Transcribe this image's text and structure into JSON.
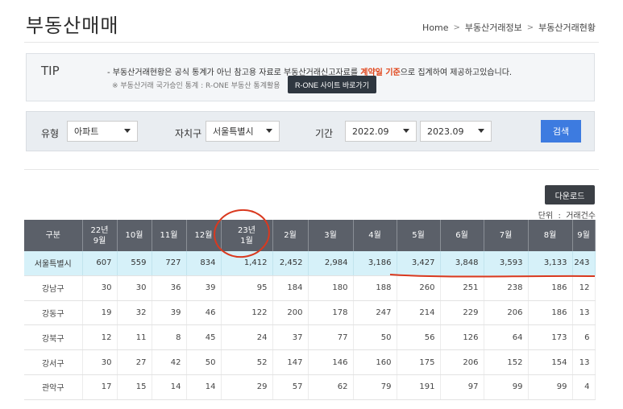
{
  "page": {
    "title": "부동산매매",
    "breadcrumb": [
      "Home",
      "부동산거래정보",
      "부동산거래현황"
    ],
    "breadcrumb_sep": ">"
  },
  "tip": {
    "label": "TIP",
    "line1_pre": "- 부동산거래현황은 공식 통계가 아닌 참고용 자료로 부동산거래신고자료를 ",
    "line1_highlight": "계약일 기준",
    "line1_post": "으로 집계하여 제공하고있습니다.",
    "line2": "※ 부동산거래 국가승인 통계 : R-ONE 부동산 통계활용",
    "rone_button": "R-ONE 사이트 바로가기"
  },
  "filters": {
    "type_label": "유형",
    "type_value": "아파트",
    "region_label": "자치구",
    "region_value": "서울특별시",
    "period_label": "기간",
    "period_start": "2022.09",
    "period_end": "2023.09",
    "search_button": "검색"
  },
  "download_button": "다운로드",
  "unit": {
    "label": "단위",
    "sep": ":",
    "value": "거래건수"
  },
  "table": {
    "headers": [
      [
        "구분"
      ],
      [
        "22년",
        "9월"
      ],
      [
        "10월"
      ],
      [
        "11월"
      ],
      [
        "12월"
      ],
      [
        "23년",
        "1월"
      ],
      [
        "2월"
      ],
      [
        "3월"
      ],
      [
        "4월"
      ],
      [
        "5월"
      ],
      [
        "6월"
      ],
      [
        "7월"
      ],
      [
        "8월"
      ],
      [
        "9월"
      ]
    ],
    "rows": [
      {
        "name": "서울특별시",
        "values": [
          "607",
          "559",
          "727",
          "834",
          "1,412",
          "2,452",
          "2,984",
          "3,186",
          "3,427",
          "3,848",
          "3,593",
          "3,133",
          "243"
        ]
      },
      {
        "name": "강남구",
        "values": [
          "30",
          "30",
          "36",
          "39",
          "95",
          "184",
          "180",
          "188",
          "260",
          "251",
          "238",
          "186",
          "12"
        ]
      },
      {
        "name": "강동구",
        "values": [
          "19",
          "32",
          "39",
          "46",
          "122",
          "200",
          "178",
          "247",
          "214",
          "229",
          "206",
          "186",
          "13"
        ]
      },
      {
        "name": "강북구",
        "values": [
          "12",
          "11",
          "8",
          "45",
          "24",
          "37",
          "77",
          "50",
          "56",
          "126",
          "64",
          "173",
          "6"
        ]
      },
      {
        "name": "강서구",
        "values": [
          "30",
          "27",
          "42",
          "50",
          "52",
          "147",
          "146",
          "160",
          "175",
          "206",
          "152",
          "154",
          "13"
        ]
      },
      {
        "name": "관악구",
        "values": [
          "17",
          "15",
          "14",
          "14",
          "29",
          "57",
          "62",
          "79",
          "191",
          "97",
          "99",
          "99",
          "4"
        ]
      }
    ]
  },
  "colors": {
    "header_bg": "#5b6069",
    "total_row_bg": "#d6f1f9",
    "highlight_text": "#e0451b",
    "search_button": "#3d7be0",
    "annotation_red": "#d9391f"
  }
}
